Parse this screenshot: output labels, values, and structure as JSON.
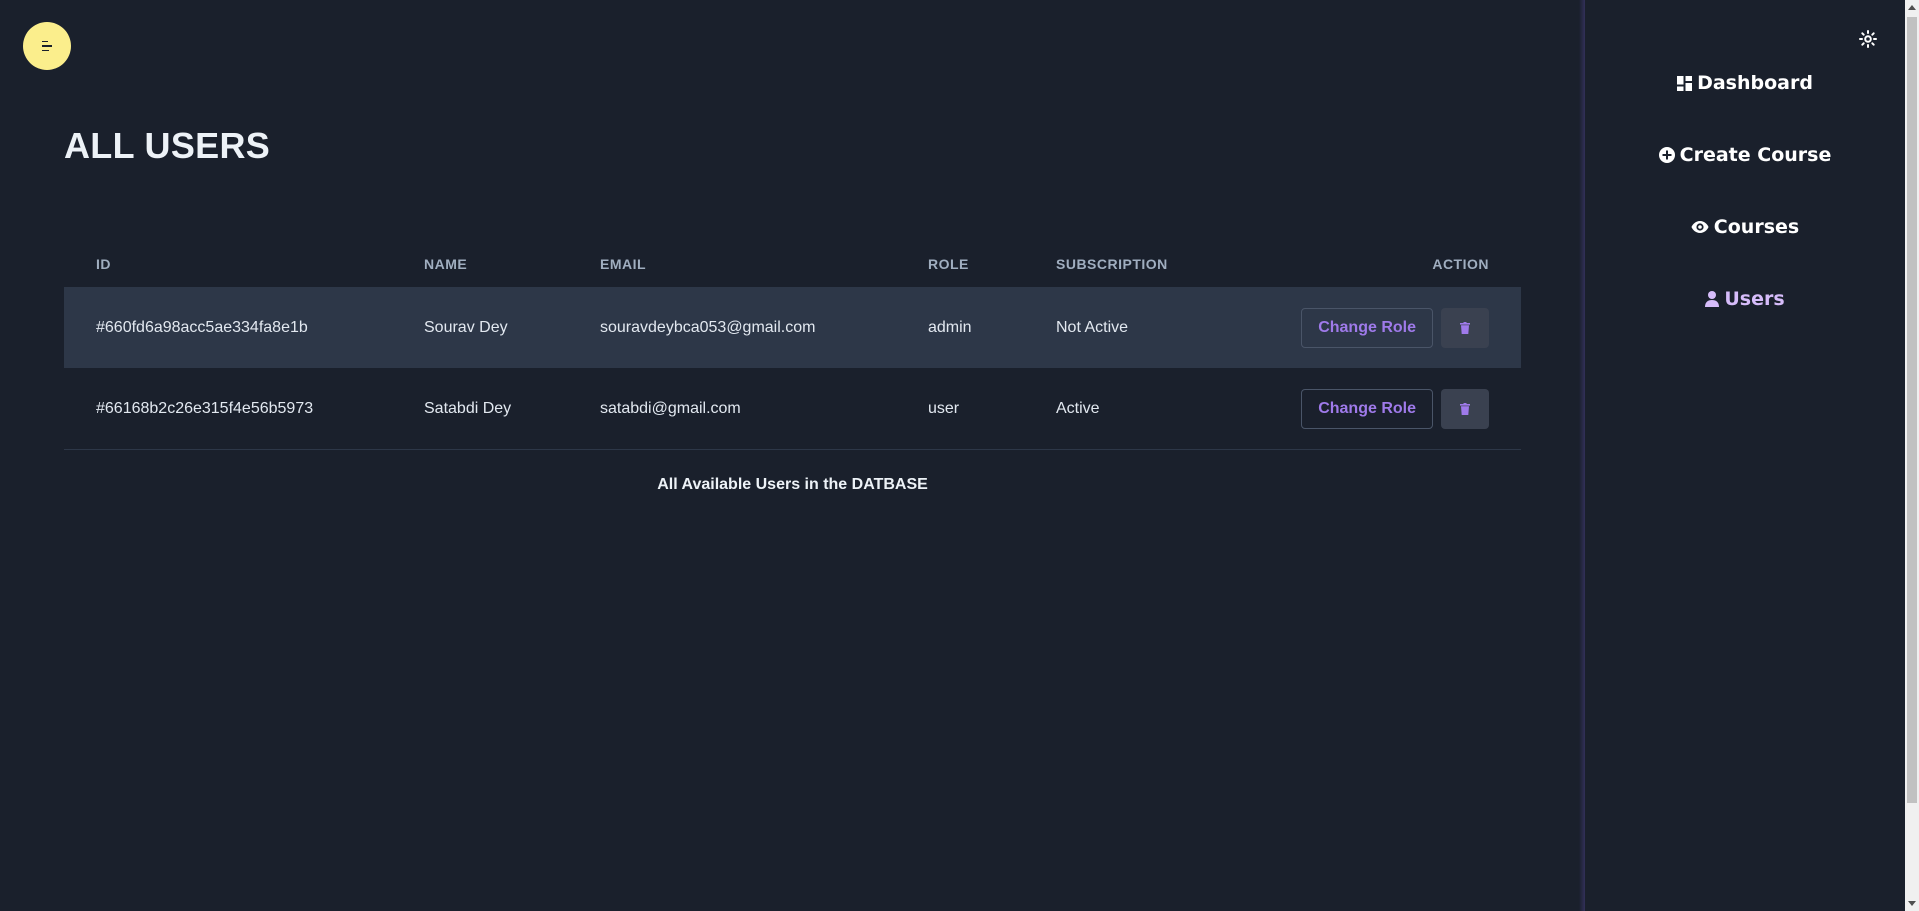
{
  "page": {
    "title": "ALL USERS",
    "caption": "All Available Users in the DATBASE"
  },
  "table": {
    "headers": {
      "id": "ID",
      "name": "NAME",
      "email": "EMAIL",
      "role": "ROLE",
      "subscription": "SUBSCRIPTION",
      "action": "ACTION"
    },
    "rows": [
      {
        "id": "#660fd6a98acc5ae334fa8e1b",
        "name": "Sourav Dey",
        "email": "souravdeybca053@gmail.com",
        "role": "admin",
        "subscription": "Not Active",
        "change_role_label": "Change Role"
      },
      {
        "id": "#66168b2c26e315f4e56b5973",
        "name": "Satabdi Dey",
        "email": "satabdi@gmail.com",
        "role": "user",
        "subscription": "Active",
        "change_role_label": "Change Role"
      }
    ]
  },
  "sidebar": {
    "items": [
      {
        "label": "Dashboard",
        "icon": "dashboard-icon"
      },
      {
        "label": "Create Course",
        "icon": "plus-circle-icon"
      },
      {
        "label": "Courses",
        "icon": "eye-icon"
      },
      {
        "label": "Users",
        "icon": "user-icon",
        "active": true
      }
    ]
  },
  "icons": {
    "menu": "menu-icon",
    "theme_toggle": "sun-icon",
    "delete": "trash-icon"
  },
  "colors": {
    "background": "#1a202c",
    "row_highlight": "#2d3748",
    "accent": "#9f7aea",
    "active_nav": "#d6bcfa",
    "menu_button": "#fbee8c"
  }
}
